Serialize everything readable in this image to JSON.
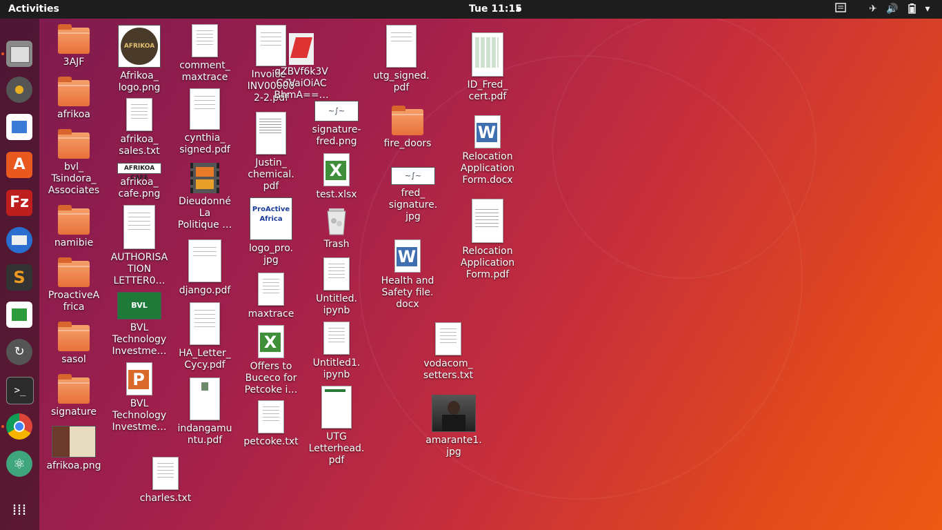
{
  "topbar": {
    "activities": "Activities",
    "clock": "Tue 11:15"
  },
  "tray_icons": [
    "menu-icon",
    "airplane-icon",
    "volume-icon",
    "battery-icon",
    "dropdown-icon"
  ],
  "dock": [
    {
      "name": "files-icon"
    },
    {
      "name": "rhythmbox-icon"
    },
    {
      "name": "libreoffice-writer-icon"
    },
    {
      "name": "software-center-icon"
    },
    {
      "name": "filezilla-icon"
    },
    {
      "name": "thunderbird-icon"
    },
    {
      "name": "sublime-text-icon"
    },
    {
      "name": "libreoffice-calc-icon"
    },
    {
      "name": "software-updater-icon"
    },
    {
      "name": "terminal-icon"
    },
    {
      "name": "chrome-icon"
    },
    {
      "name": "atom-icon"
    },
    {
      "name": "show-apps-icon"
    }
  ],
  "desktop": {
    "items": [
      {
        "label": "3AJF"
      },
      {
        "label": "afrikoa"
      },
      {
        "label": "bvl_\nTsindora_\nAssociates"
      },
      {
        "label": "namibie"
      },
      {
        "label": "ProactiveA\nfrica"
      },
      {
        "label": "sasol"
      },
      {
        "label": "signature"
      },
      {
        "label": "afrikoa.png"
      },
      {
        "label": "Afrikoa_\nlogo.png"
      },
      {
        "label": "afrikoa_\nsales.txt"
      },
      {
        "label": "afrikoa_\ncafe.png"
      },
      {
        "label": "AUTHORISA\nTION\nLETTER0…"
      },
      {
        "label": "BVL\nTechnology\nInvestme…"
      },
      {
        "label": "BVL\nTechnology\nInvestme…"
      },
      {
        "label": "charles.txt"
      },
      {
        "label": "comment_\nmaxtrace"
      },
      {
        "label": "cynthia_\nsigned.pdf"
      },
      {
        "label": "Dieudonné\nLa\nPolitique …"
      },
      {
        "label": "django.pdf"
      },
      {
        "label": "HA_Letter_\nCycy.pdf"
      },
      {
        "label": "indangamu\nntu.pdf"
      },
      {
        "label": "Invoice_\nINV00000\n2-2.pdf"
      },
      {
        "label": "qZBVf6k3V\nCoVaiOiAC\nBhmA==…"
      },
      {
        "label": "Justin_\nchemical.\npdf"
      },
      {
        "label": "logo_pro.\njpg"
      },
      {
        "label": "maxtrace"
      },
      {
        "label": "Offers to\nBuceco for\nPetcoke i…"
      },
      {
        "label": "petcoke.txt"
      },
      {
        "label": "signature-\nfred.png"
      },
      {
        "label": "test.xlsx"
      },
      {
        "label": "Trash"
      },
      {
        "label": "Untitled.\nipynb"
      },
      {
        "label": "Untitled1.\nipynb"
      },
      {
        "label": "UTG\nLetterhead.\npdf"
      },
      {
        "label": "utg_signed.\npdf"
      },
      {
        "label": "fire_doors"
      },
      {
        "label": "fred_\nsignature.\njpg"
      },
      {
        "label": "Health and\nSafety file.\ndocx"
      },
      {
        "label": "vodacom_\nsetters.txt"
      },
      {
        "label": "amarante1.\njpg"
      },
      {
        "label": "ID_Fred_\ncert.pdf"
      },
      {
        "label": "Relocation\nApplication\nForm.docx"
      },
      {
        "label": "Relocation\nApplication\nForm.pdf"
      }
    ],
    "thumb_text": {
      "afrikoa_logo": "AFRIKOA",
      "afrikoa_cafe": "AFRIKOA CAFE",
      "bvl": "BVL",
      "proactive": "ProActive Africa",
      "excel": "X",
      "word": "W",
      "ppt": "P"
    }
  },
  "colors": {
    "accent": "#e95420",
    "topbar": "#1d1d1d"
  }
}
